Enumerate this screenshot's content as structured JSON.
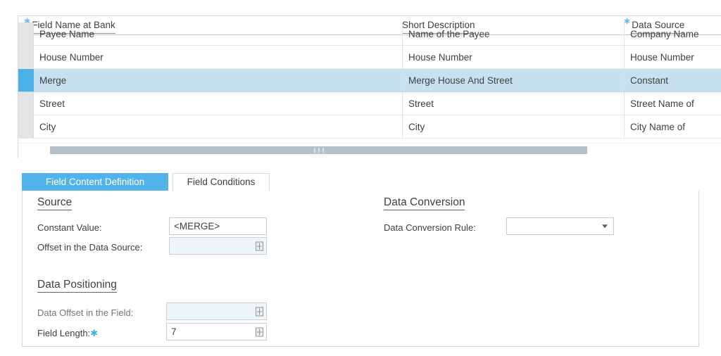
{
  "table": {
    "columns": [
      {
        "label": "Field Name at Bank",
        "required": true
      },
      {
        "label": "Short Description",
        "required": false
      },
      {
        "label": "Data Source",
        "required": true
      }
    ],
    "rows": [
      {
        "field_name": "Payee Name",
        "short_description": "Name of the Payee",
        "data_source": "Company Name",
        "selected": false,
        "clipped": true
      },
      {
        "field_name": "House Number",
        "short_description": "House Number",
        "data_source": "House Number",
        "selected": false,
        "clipped": false
      },
      {
        "field_name": "Merge",
        "short_description": "Merge House And Street",
        "data_source": "Constant",
        "selected": true,
        "clipped": false
      },
      {
        "field_name": "Street",
        "short_description": "Street",
        "data_source": "Street Name of",
        "selected": false,
        "clipped": false
      },
      {
        "field_name": "City",
        "short_description": "City",
        "data_source": "City Name of",
        "selected": false,
        "clipped": false
      }
    ],
    "scrollbar": {
      "orientation": "horizontal",
      "grip": "grip-dots"
    }
  },
  "tabs": [
    {
      "label": "Field Content Definition",
      "active": true
    },
    {
      "label": "Field Conditions",
      "active": false
    }
  ],
  "form": {
    "source": {
      "heading": "Source",
      "constant_value_label": "Constant Value:",
      "constant_value": "<MERGE>",
      "offset_label": "Offset in the Data Source:",
      "offset_value": "",
      "offset_disabled": true
    },
    "data_conversion": {
      "heading": "Data Conversion",
      "rule_label": "Data Conversion Rule:",
      "rule_value": ""
    },
    "data_positioning": {
      "heading": "Data Positioning",
      "data_offset_label": "Data Offset in the Field:",
      "data_offset_value": "",
      "data_offset_disabled": true,
      "field_length_label": "Field Length:",
      "field_length_required": true,
      "field_length_value": "7"
    }
  },
  "colors": {
    "accent_blue": "#51b3ea",
    "selected_row": "#c7e1f1",
    "handle_selected": "#4db1e8",
    "required_star": "#44afe6",
    "scrollbar_thumb": "#b6c0c8",
    "border": "#d5d8da",
    "text": "#3b4146",
    "disabled_field": "#eef5f9"
  }
}
